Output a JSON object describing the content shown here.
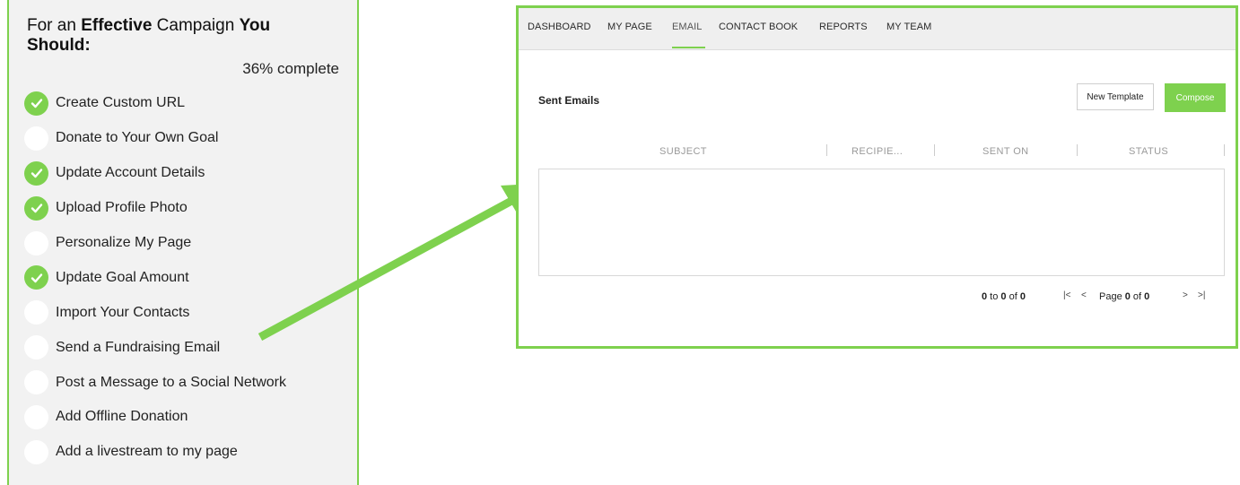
{
  "checklist": {
    "title_parts": {
      "p1": "For an ",
      "p2": "Effective",
      "p3": " Campaign ",
      "p4": "You Should:"
    },
    "progress_text": "36% complete",
    "tasks": [
      {
        "label": "Create Custom URL",
        "done": true
      },
      {
        "label": "Donate to Your Own Goal",
        "done": false
      },
      {
        "label": "Update Account Details",
        "done": true
      },
      {
        "label": "Upload Profile Photo",
        "done": true
      },
      {
        "label": "Personalize My Page",
        "done": false
      },
      {
        "label": "Update Goal Amount",
        "done": true
      },
      {
        "label": "Import Your Contacts",
        "done": false
      },
      {
        "label": "Send a Fundraising Email",
        "done": false
      },
      {
        "label": "Post a Message to a Social Network",
        "done": false
      },
      {
        "label": "Add Offline Donation",
        "done": false
      },
      {
        "label": "Add a livestream to my page",
        "done": false
      }
    ]
  },
  "email_app": {
    "nav": {
      "tabs": [
        "DASHBOARD",
        "MY PAGE",
        "EMAIL",
        "CONTACT BOOK",
        "REPORTS",
        "MY TEAM"
      ],
      "active": "EMAIL"
    },
    "section_title": "Sent Emails",
    "buttons": {
      "new_template": "New Template",
      "compose": "Compose"
    },
    "table": {
      "columns": [
        "SUBJECT",
        "RECIPIE...",
        "SENT ON",
        "STATUS"
      ]
    },
    "pager": {
      "summary_prefix": "0",
      "summary_mid": " to ",
      "summary_to": "0",
      "summary_of": " of ",
      "summary_total": "0",
      "first": "|<",
      "prev": "<",
      "page_label": "Page ",
      "page_current": "0",
      "page_of": " of ",
      "page_total": "0",
      "next": ">",
      "last": ">|"
    }
  },
  "colors": {
    "accent": "#7ed14e",
    "panel_bg": "#f2f2f2",
    "nav_bg": "#efefef"
  }
}
